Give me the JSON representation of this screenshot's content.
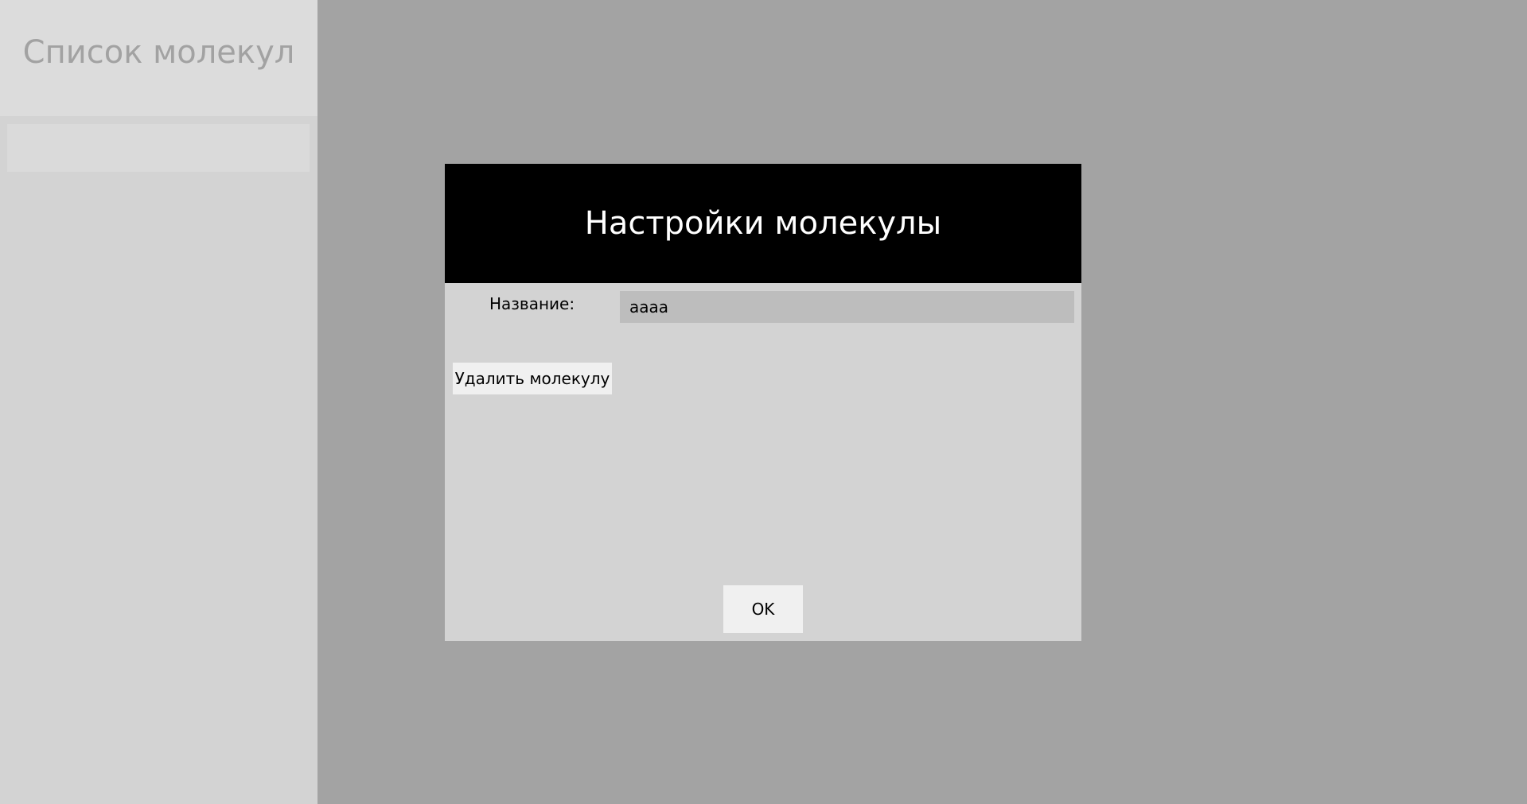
{
  "sidebar": {
    "title": "Список молекул",
    "items": [
      ""
    ]
  },
  "modal": {
    "title": "Настройки молекулы",
    "name_label": "Название:",
    "name_value": "aaaa",
    "delete_label": "Удалить молекулу",
    "ok_label": "OK"
  },
  "colors": {
    "sidebar_bg": "#d3d3d3",
    "overlay_bg": "#a3a3a3",
    "modal_header_bg": "#000000",
    "modal_body_bg": "#d3d3d3",
    "input_bg": "#bdbdbd",
    "button_bg": "#f0f0f0"
  }
}
